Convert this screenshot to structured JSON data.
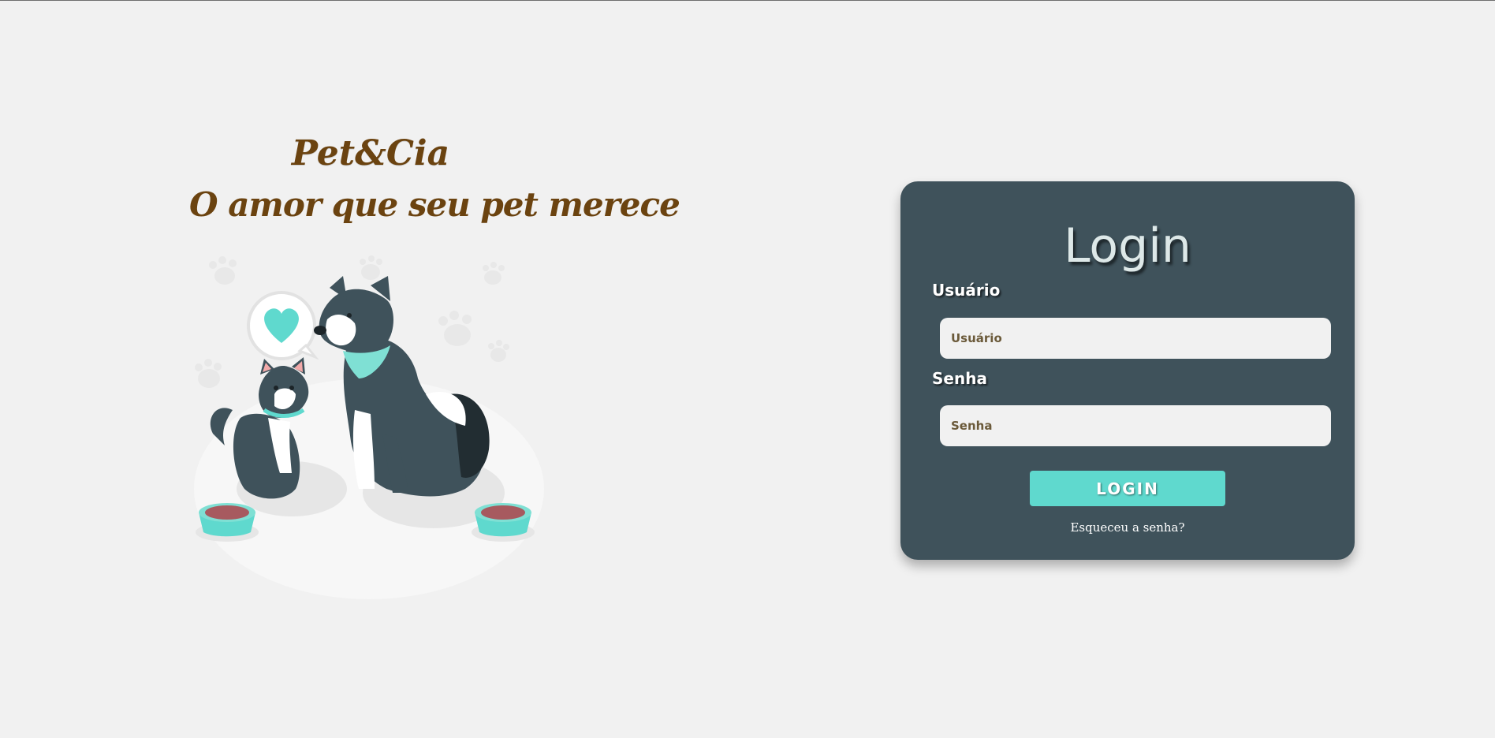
{
  "brand": {
    "name": "Pet&Cia",
    "tagline": "O amor que seu pet merece"
  },
  "illustration": {
    "icon": "dog-and-cat-illustration"
  },
  "login": {
    "title": "Login",
    "username_label": "Usuário",
    "username_placeholder": "Usuário",
    "password_label": "Senha",
    "password_placeholder": "Senha",
    "submit_label": "LOGIN",
    "forgot_label": "Esqueceu a senha?"
  },
  "colors": {
    "background": "#f1f1f1",
    "card": "#3f525b",
    "accent": "#5fd9ce",
    "brand": "#6b4310"
  }
}
